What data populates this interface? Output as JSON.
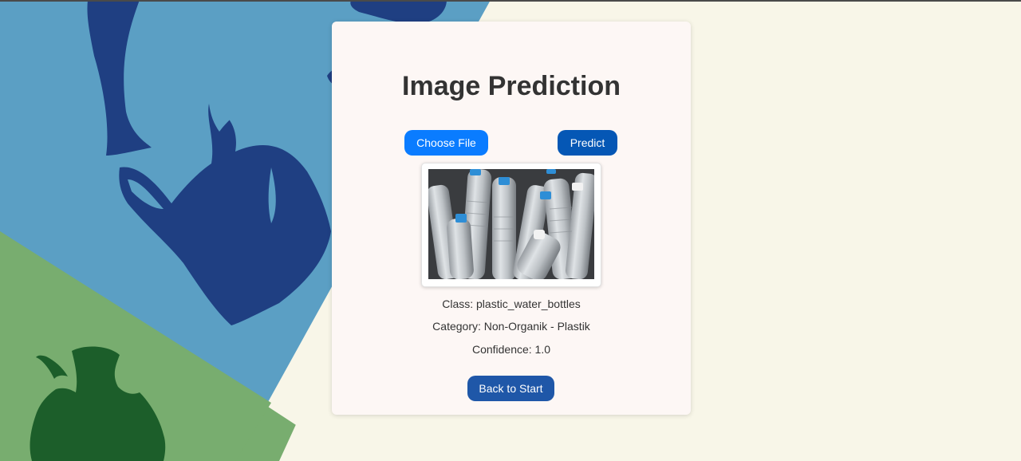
{
  "page": {
    "title": "Image Prediction"
  },
  "controls": {
    "choose_file_label": "Choose File",
    "predict_label": "Predict",
    "back_label": "Back to Start"
  },
  "result": {
    "class_text": "Class: plastic_water_bottles",
    "category_text": "Category: Non-Organik - Plastik",
    "confidence_text": "Confidence: 1.0"
  },
  "colors": {
    "background_cream": "#f8f6e8",
    "background_blue": "#5b9fc4",
    "background_green": "#78ad6f",
    "bag_navy": "#1f3f82",
    "apple_green": "#1c5e2a",
    "card": "#fdf7f5",
    "choose_button": "#0a7cff",
    "predict_button": "#0557b5",
    "back_button": "#1f57a8"
  },
  "icons": {
    "background_bag": "plastic-bag-icon",
    "background_apple": "apple-core-icon"
  }
}
